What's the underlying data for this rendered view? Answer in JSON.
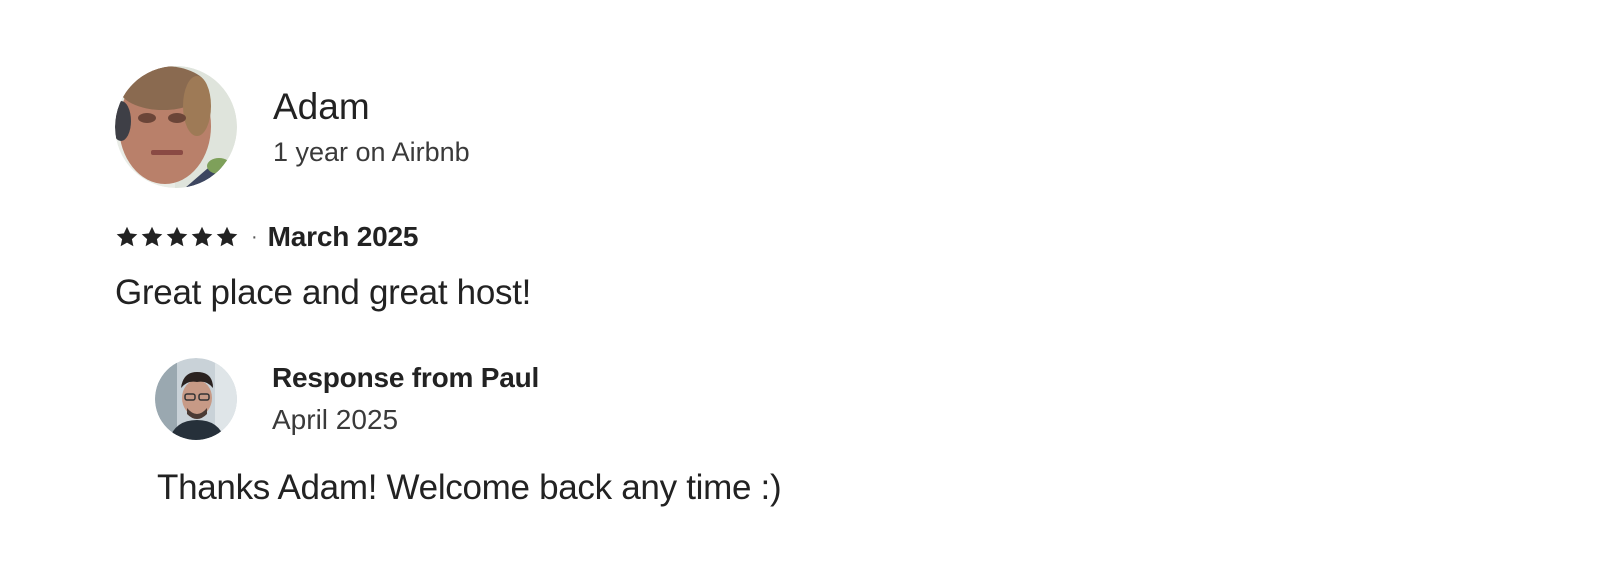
{
  "review": {
    "reviewer": {
      "name": "Adam",
      "tenure": "1 year on Airbnb",
      "avatar_icon": "user-photo-avatar"
    },
    "rating": {
      "stars": 5,
      "max_stars": 5,
      "separator": "·",
      "date": "March 2025"
    },
    "text": "Great place and great host!",
    "host_response": {
      "title": "Response from Paul",
      "date": "April 2025",
      "avatar_icon": "host-photo-avatar",
      "text": "Thanks Adam! Welcome back any time :)"
    }
  },
  "colors": {
    "text_primary": "#222222",
    "text_secondary": "#3a3a3a",
    "background": "#ffffff"
  }
}
